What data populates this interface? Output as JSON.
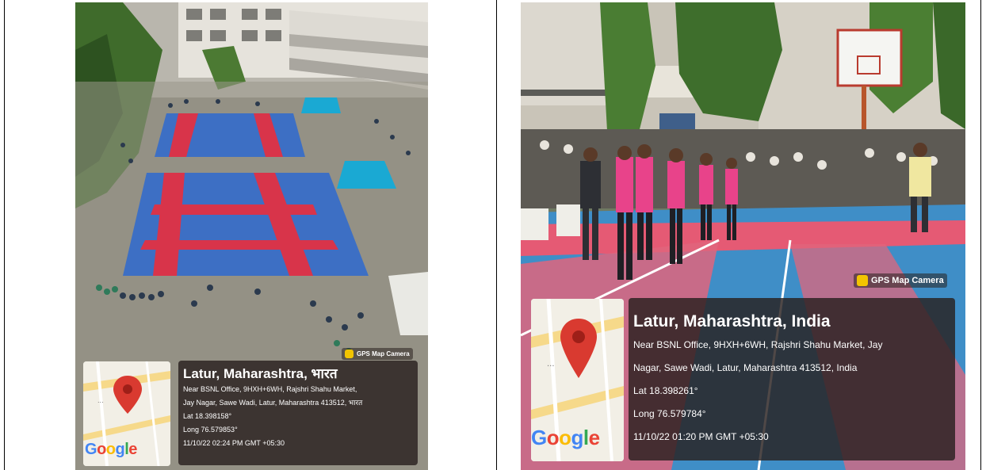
{
  "photos": [
    {
      "label": "Aerial view of kabaddi courts in campus courtyard",
      "watermark": "GPS Map Camera",
      "title": "Latur, Maharashtra, भारत",
      "lines": [
        "Near BSNL Office, 9HXH+6WH, Rajshri Shahu Market,",
        "Jay Nagar, Sawe Wadi, Latur, Maharashtra 413512, भारत",
        "Lat 18.398158°",
        "Long 76.579853°",
        "11/10/22 02:24 PM GMT +05:30"
      ],
      "map_logo": "Google"
    },
    {
      "label": "Players lined up on kabaddi court",
      "watermark": "GPS Map Camera",
      "title": "Latur, Maharashtra, India",
      "lines": [
        "Near BSNL Office, 9HXH+6WH, Rajshri Shahu Market, Jay",
        "Nagar, Sawe Wadi, Latur, Maharashtra 413512, India",
        "Lat 18.398261°",
        "Long 76.579784°",
        "11/10/22 01:20 PM GMT +05:30"
      ],
      "map_logo": "Google"
    }
  ],
  "colors": {
    "court_blue": "#3d6fc4",
    "court_red": "#d8344a",
    "overlay": "#28201e",
    "map_pin": "#d93a30"
  }
}
